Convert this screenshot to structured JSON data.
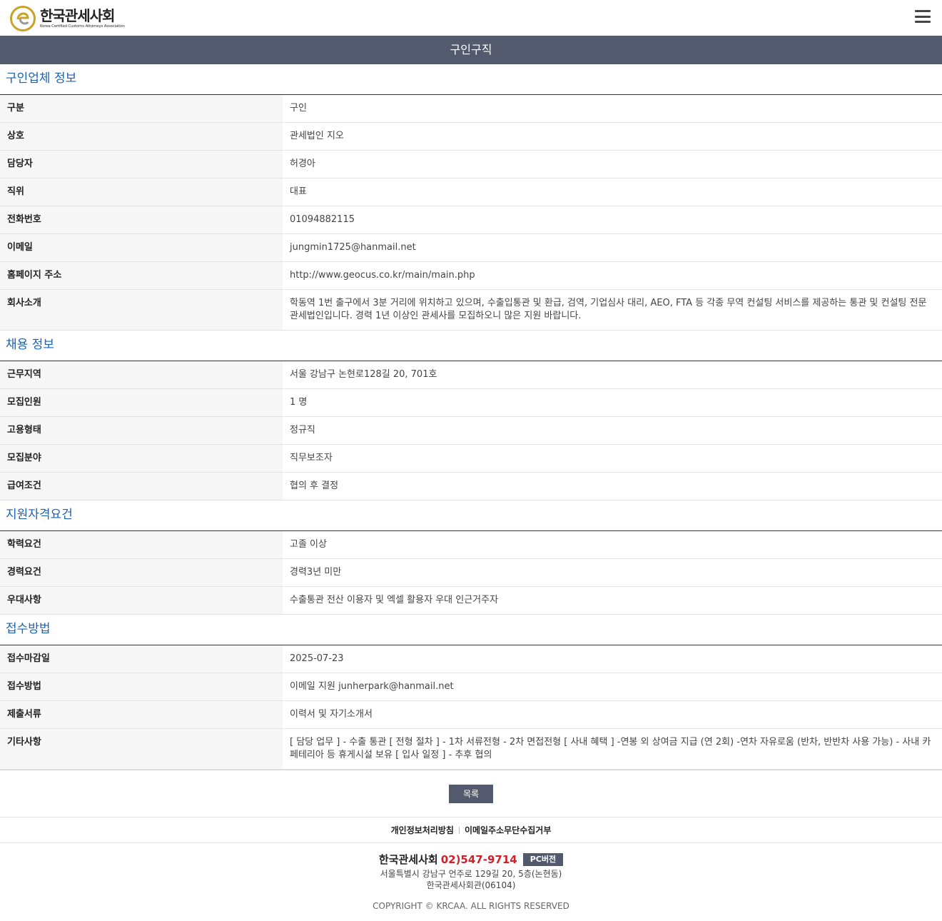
{
  "header": {
    "logo_title": "한국관세사회",
    "logo_sub": "Korea Certified Customs Attorneys Association"
  },
  "page_title": "구인구직",
  "sections": {
    "company": {
      "title": "구인업체 정보",
      "rows": [
        {
          "label": "구분",
          "value": "구인"
        },
        {
          "label": "상호",
          "value": "관세법인 지오"
        },
        {
          "label": "담당자",
          "value": "허경아"
        },
        {
          "label": "직위",
          "value": "대표"
        },
        {
          "label": "전화번호",
          "value": "01094882115"
        },
        {
          "label": "이메일",
          "value": "jungmin1725@hanmail.net"
        },
        {
          "label": "홈페이지 주소",
          "value": "http://www.geocus.co.kr/main/main.php"
        },
        {
          "label": "회사소개",
          "value": "학동역 1번 출구에서 3분 거리에 위치하고 있으며, 수출입통관 및 환급, 검역, 기업심사 대리, AEO, FTA 등 각종 무역 컨설팅 서비스를 제공하는 통관 및 컨설팅 전문 관세법인입니다. 경력 1년 이상인 관세사를 모집하오니 많은 지원 바랍니다."
        }
      ]
    },
    "recruit": {
      "title": "채용 정보",
      "rows": [
        {
          "label": "근무지역",
          "value": "서울 강남구 논현로128길 20, 701호"
        },
        {
          "label": "모집인원",
          "value": "1 명"
        },
        {
          "label": "고용형태",
          "value": "정규직"
        },
        {
          "label": "모집분야",
          "value": "직무보조자"
        },
        {
          "label": "급여조건",
          "value": "협의 후 결정"
        }
      ]
    },
    "qualification": {
      "title": "지원자격요건",
      "rows": [
        {
          "label": "학력요건",
          "value": "고졸 이상"
        },
        {
          "label": "경력요건",
          "value": "경력3년 미만"
        },
        {
          "label": "우대사항",
          "value": "수출통관 전산 이용자 및 엑셀 활용자 우대 인근거주자"
        }
      ]
    },
    "apply": {
      "title": "접수방법",
      "rows": [
        {
          "label": "접수마감일",
          "value": "2025-07-23"
        },
        {
          "label": "접수방법",
          "value": "이메일 지원 junherpark@hanmail.net"
        },
        {
          "label": "제출서류",
          "value": "이력서 및 자기소개서"
        },
        {
          "label": "기타사항",
          "value": "[ 담당 업무 ] - 수출 통관 [ 전형 절차 ] - 1차 서류전형 - 2차 면접전형 [ 사내 혜택 ] -연봉 외 상여금 지급 (연 2회) -연차 자유로움 (반차, 반반차 사용 가능) - 사내 카페테리아 등 휴게시설 보유 [ 입사 일정 ] - 추후 협의"
        }
      ]
    }
  },
  "buttons": {
    "list_label": "목록"
  },
  "footer": {
    "links": [
      "개인정보처리방침",
      "이메일주소무단수집거부"
    ],
    "org_name": "한국관세사회",
    "phone": "02)547-9714",
    "pc_label": "PC버전",
    "address1": "서울특별시 강남구 언주로 129길 20, 5층(논현동)",
    "address2": "한국관세사회관(06104)",
    "copyright": "COPYRIGHT © KRCAA. ALL RIGHTS RESERVED"
  },
  "colors": {
    "accent": "#545a6e",
    "section_title": "#1a63b5",
    "phone": "#d0202a",
    "logo_gold": "#c9a227"
  },
  "icons": {
    "logo": "krcaa-logo-icon",
    "menu": "hamburger-menu-icon"
  }
}
